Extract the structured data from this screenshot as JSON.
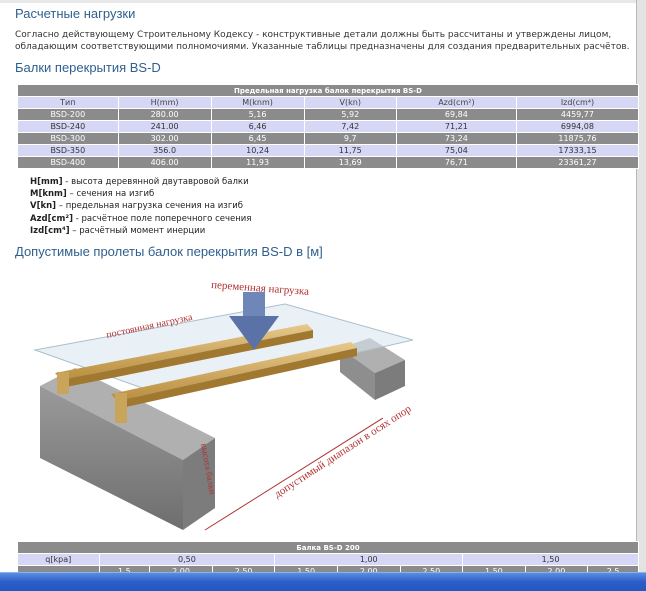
{
  "section1": {
    "title": "Расчетные нагрузки",
    "paragraph": "Согласно действующему Строительному Кодексу - конструктивные детали должны быть рассчитаны и утверждены лицом, обладающим соответствующими полномочиями. Указанные таблицы предназначены для создания предварительных расчётов."
  },
  "section2": {
    "title": "Балки перекрытия BS-D",
    "table_caption": "Предельная нагрузка балок перекрытия BS-D",
    "headers": [
      "Тип",
      "H(mm)",
      "M(knm)",
      "V(kn)",
      "Azd(cm²)",
      "Izd(cm⁴)"
    ],
    "rows": [
      [
        "BSD-200",
        "280.00",
        "5,16",
        "5,92",
        "69,84",
        "4459,77"
      ],
      [
        "BSD-240",
        "241.00",
        "6,46",
        "7,42",
        "71,21",
        "6994,08"
      ],
      [
        "BSD-300",
        "302.00",
        "6,45",
        "9,7",
        "73,24",
        "11875,76"
      ],
      [
        "BSD-350",
        "356.0",
        "10,24",
        "11,75",
        "75,04",
        "17333,15"
      ],
      [
        "BSD-400",
        "406.00",
        "11,93",
        "13,69",
        "76,71",
        "23361,27"
      ]
    ]
  },
  "legend": [
    {
      "term": "H[mm]",
      "desc": " - высота деревянной двутавровой балки"
    },
    {
      "term": "M[knm]",
      "desc": " – сечения на изгиб"
    },
    {
      "term": "V[kn]",
      "desc": " – предельная нагрузка сечения на изгиб"
    },
    {
      "term": "Azd[cm²]",
      "desc": " - расчётное поле поперечного сечения"
    },
    {
      "term": "Izd[cm⁴]",
      "desc": " – расчётный момент инерции"
    }
  ],
  "section3": {
    "title": "Допустимые пролеты балок перекрытия BS-D в [м]"
  },
  "illustration": {
    "label_variable_load": "переменная нагрузка",
    "label_constant_load": "постоянная нагрузка",
    "label_height": "высота балки",
    "label_span": "допустимый диапазон в осях опор"
  },
  "span_table": {
    "caption": "Балка BS-D 200",
    "q_label": "q[kpa]",
    "q_values": [
      "0,50",
      "1,00",
      "1,50"
    ],
    "second_row": [
      "1,5",
      "2,00",
      "2,50",
      "1,50",
      "2,00",
      "2,50",
      "1,50",
      "2,00",
      "2,5"
    ]
  }
}
